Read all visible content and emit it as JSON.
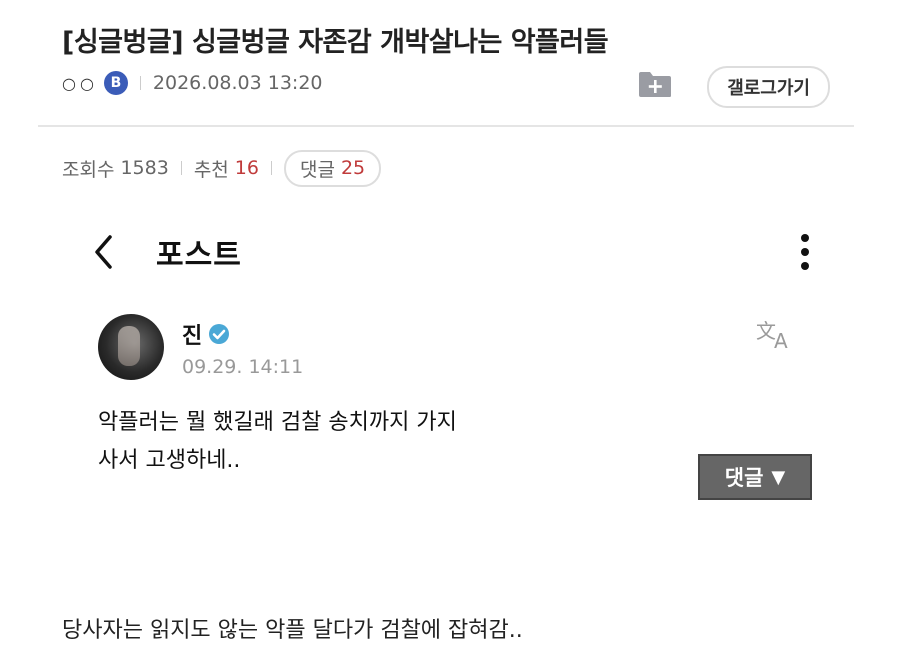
{
  "article": {
    "title": "[싱글벙글] 싱글벙글 자존감 개박살나는 악플러들",
    "author_dots": "○○",
    "author_badge": "B",
    "date": "2026.08.03 13:20",
    "gallery_button": "갤로그가기"
  },
  "stats": {
    "views_label": "조회수",
    "views": "1583",
    "recommend_label": "추천",
    "recommend": "16",
    "comments_label": "댓글",
    "comments": "25"
  },
  "embedded_post": {
    "header_title": "포스트",
    "author_name": "진",
    "timestamp": "09.29. 14:11",
    "text": "악플러는 뭘 했길래 검찰 송치까지 가지\n사서 고생하네..",
    "reply_button": "댓글",
    "reply_arrow": "▼"
  },
  "caption": "당사자는 읽지도 않는 악플 달다가 검찰에 잡혀감..",
  "colors": {
    "badge": "#3b5cb8",
    "accent_red": "#c03b3b",
    "verified": "#4aa8d6",
    "reply_button": "#666666"
  },
  "icons": {
    "folder_add": "folder-add-icon",
    "back": "chevron-left-icon",
    "more": "vertical-dots-icon",
    "verified": "verified-badge-icon",
    "translate": "translate-icon"
  }
}
